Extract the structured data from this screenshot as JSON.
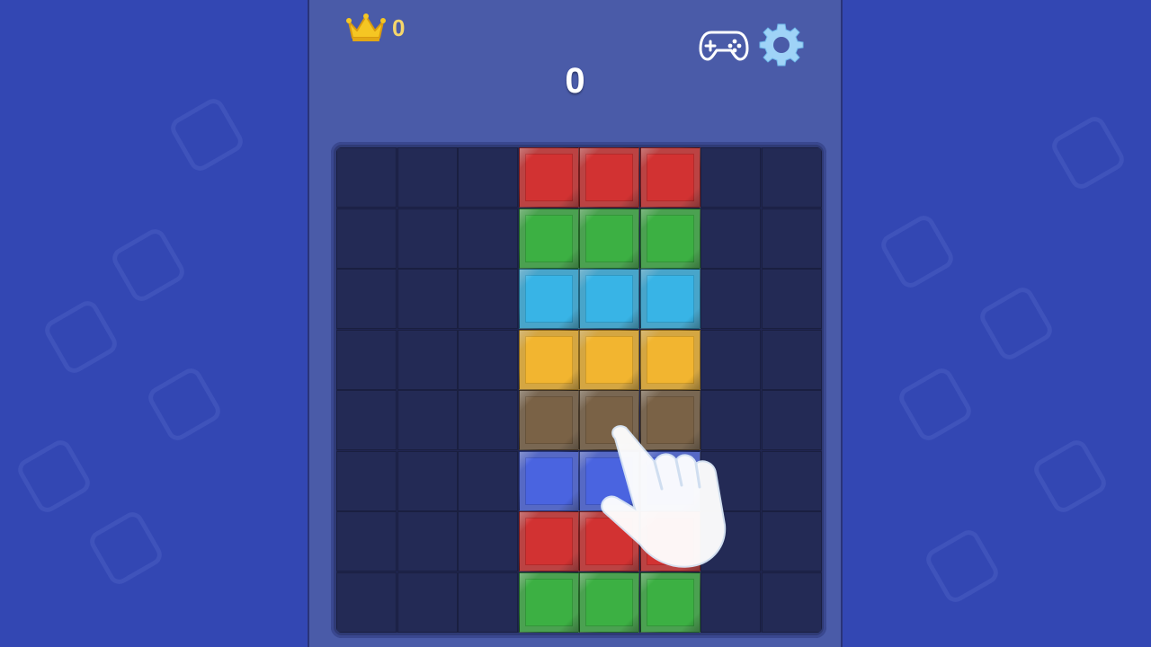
{
  "header": {
    "best_score": "0",
    "score": "0"
  },
  "icons": {
    "best": "crown-icon",
    "games": "gamepad-icon",
    "settings": "gear-icon",
    "hint": "pointing-hand-icon"
  },
  "colors": {
    "background": "#3347b3",
    "panel": "#4a5ba8",
    "board": "#232a55",
    "crown": "#f5c623",
    "red": "#d23232",
    "green": "#3cb043",
    "cyan": "#38b4e6",
    "yellow": "#f2b530",
    "brown": "#7a6246",
    "blue": "#4a64e0"
  },
  "board": {
    "rows": [
      [
        "",
        "",
        "",
        "red",
        "red",
        "red",
        "",
        ""
      ],
      [
        "",
        "",
        "",
        "green",
        "green",
        "green",
        "",
        ""
      ],
      [
        "",
        "",
        "",
        "cyan",
        "cyan",
        "cyan",
        "",
        ""
      ],
      [
        "",
        "",
        "",
        "yellow",
        "yellow",
        "yellow",
        "",
        ""
      ],
      [
        "",
        "",
        "",
        "brown",
        "brown",
        "brown",
        "",
        ""
      ],
      [
        "",
        "",
        "",
        "blue",
        "blue",
        "blue",
        "",
        ""
      ],
      [
        "",
        "",
        "",
        "red",
        "red",
        "red",
        "",
        ""
      ],
      [
        "",
        "",
        "",
        "green",
        "green",
        "green",
        "",
        ""
      ]
    ]
  }
}
